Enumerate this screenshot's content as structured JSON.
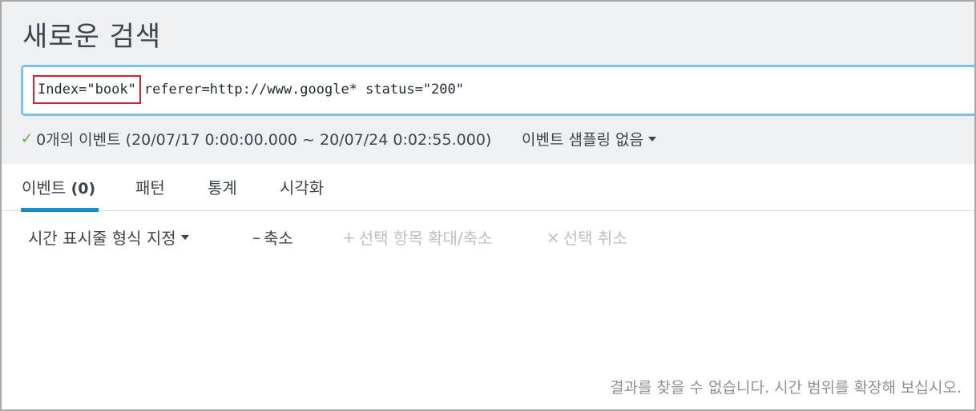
{
  "header": {
    "title": "새로운 검색"
  },
  "search": {
    "query_index": "Index=\"book\"",
    "query_rest": "referer=http://www.google* status=\"200\""
  },
  "status": {
    "events_text": "0개의 이벤트 (20/07/17 0:00:00.000 ~ 20/07/24 0:02:55.000)",
    "sampling_label": "이벤트 샘플링 없음"
  },
  "tabs": {
    "events_label": "이벤트",
    "events_count": "(0)",
    "patterns_label": "패턴",
    "statistics_label": "통계",
    "visualization_label": "시각화"
  },
  "toolbar": {
    "time_format_label": "시간 표시줄 형식 지정",
    "zoom_out_label": "축소",
    "zoom_selection_label": "선택 항목 확대/축소",
    "deselect_label": "선택 취소"
  },
  "results": {
    "empty_message": "결과를 찾을 수 없습니다. 시간 범위를 확장해 보십시오."
  }
}
